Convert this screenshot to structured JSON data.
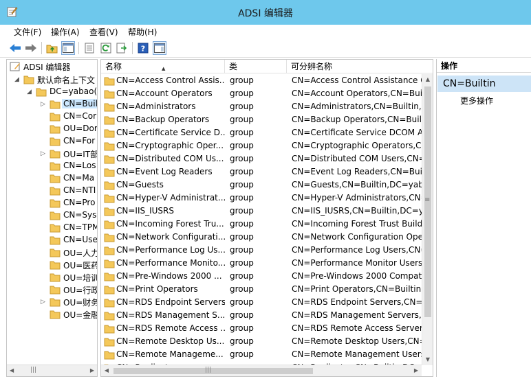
{
  "window": {
    "title": "ADSI 编辑器"
  },
  "menu": [
    "文件(F)",
    "操作(A)",
    "查看(V)",
    "帮助(H)"
  ],
  "toolbar": {
    "buttons": [
      "back-arrow-icon",
      "forward-arrow-icon",
      "up-folder-icon",
      "show-tree-icon",
      "properties-icon",
      "refresh-icon",
      "export-list-icon",
      "help-icon",
      "show-action-pane-icon"
    ]
  },
  "tree": {
    "root": "ADSI 编辑器",
    "context": "默认命名上下文",
    "domain": "DC=yabao(",
    "items": [
      "CN=Buil",
      "CN=Cor",
      "OU=Dor",
      "CN=For",
      "OU=IT部",
      "CN=Los",
      "CN=Ma",
      "CN=NTI",
      "CN=Pro",
      "CN=Sys",
      "CN=TPM",
      "CN=Use",
      "OU=人力",
      "OU=医药",
      "OU=培训",
      "OU=行政",
      "OU=财务",
      "OU=金融"
    ]
  },
  "list": {
    "columns": [
      "名称",
      "类",
      "可分辨名称"
    ],
    "rows": [
      {
        "name": "CN=Access Control Assis...",
        "cls": "group",
        "dn": "CN=Access Control Assistance O"
      },
      {
        "name": "CN=Account Operators",
        "cls": "group",
        "dn": "CN=Account Operators,CN=Buil"
      },
      {
        "name": "CN=Administrators",
        "cls": "group",
        "dn": "CN=Administrators,CN=Builtin,D"
      },
      {
        "name": "CN=Backup Operators",
        "cls": "group",
        "dn": "CN=Backup Operators,CN=Built"
      },
      {
        "name": "CN=Certificate Service D...",
        "cls": "group",
        "dn": "CN=Certificate Service DCOM Ac"
      },
      {
        "name": "CN=Cryptographic Oper...",
        "cls": "group",
        "dn": "CN=Cryptographic Operators,CN"
      },
      {
        "name": "CN=Distributed COM Us...",
        "cls": "group",
        "dn": "CN=Distributed COM Users,CN="
      },
      {
        "name": "CN=Event Log Readers",
        "cls": "group",
        "dn": "CN=Event Log Readers,CN=Built"
      },
      {
        "name": "CN=Guests",
        "cls": "group",
        "dn": "CN=Guests,CN=Builtin,DC=yaba"
      },
      {
        "name": "CN=Hyper-V Administrat...",
        "cls": "group",
        "dn": "CN=Hyper-V Administrators,CN="
      },
      {
        "name": "CN=IIS_IUSRS",
        "cls": "group",
        "dn": "CN=IIS_IUSRS,CN=Builtin,DC=ya"
      },
      {
        "name": "CN=Incoming Forest Tru...",
        "cls": "group",
        "dn": "CN=Incoming Forest Trust Builde"
      },
      {
        "name": "CN=Network Configurati...",
        "cls": "group",
        "dn": "CN=Network Configuration Ope"
      },
      {
        "name": "CN=Performance Log Us...",
        "cls": "group",
        "dn": "CN=Performance Log Users,CN="
      },
      {
        "name": "CN=Performance Monito...",
        "cls": "group",
        "dn": "CN=Performance Monitor Users"
      },
      {
        "name": "CN=Pre-Windows 2000 ...",
        "cls": "group",
        "dn": "CN=Pre-Windows 2000 Compati"
      },
      {
        "name": "CN=Print Operators",
        "cls": "group",
        "dn": "CN=Print Operators,CN=Builtin,D"
      },
      {
        "name": "CN=RDS Endpoint Servers",
        "cls": "group",
        "dn": "CN=RDS Endpoint Servers,CN=B"
      },
      {
        "name": "CN=RDS Management S...",
        "cls": "group",
        "dn": "CN=RDS Management Servers,C"
      },
      {
        "name": "CN=RDS Remote Access ...",
        "cls": "group",
        "dn": "CN=RDS Remote Access Servers"
      },
      {
        "name": "CN=Remote Desktop Us...",
        "cls": "group",
        "dn": "CN=Remote Desktop Users,CN="
      },
      {
        "name": "CN=Remote Manageme...",
        "cls": "group",
        "dn": "CN=Remote Management Users"
      },
      {
        "name": "CN=Replicator",
        "cls": "group",
        "dn": "CN=Replicator,CN=Builtin,DC="
      }
    ]
  },
  "actions": {
    "header": "操作",
    "selected": "CN=Builtin",
    "more": "更多操作"
  },
  "colors": {
    "titlebar": "#6ec8ec",
    "selection": "#cde4f7",
    "folder": "#f4c85a"
  }
}
